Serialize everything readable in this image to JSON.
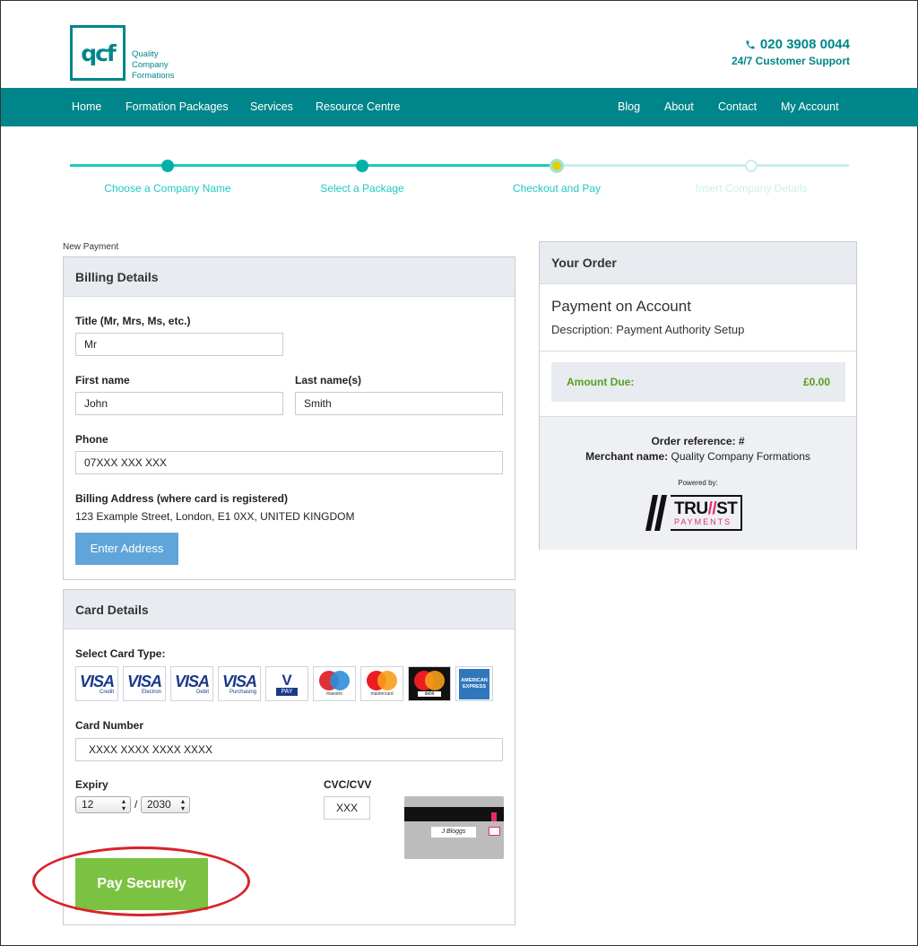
{
  "header": {
    "logo_mark": "qcf",
    "logo_lines": [
      "Quality",
      "Company",
      "Formations"
    ],
    "phone": "020 3908 0044",
    "support": "24/7 Customer Support"
  },
  "nav": {
    "left": [
      "Home",
      "Formation Packages",
      "Services",
      "Resource Centre"
    ],
    "right": [
      "Blog",
      "About",
      "Contact",
      "My Account"
    ]
  },
  "steps": [
    {
      "label": "Choose a Company Name",
      "state": "done"
    },
    {
      "label": "Select a Package",
      "state": "done"
    },
    {
      "label": "Checkout and Pay",
      "state": "current"
    },
    {
      "label": "Insert Company Details",
      "state": "todo"
    }
  ],
  "page": {
    "new_payment": "New Payment"
  },
  "billing": {
    "title": "Billing Details",
    "title_label": "Title (Mr, Mrs, Ms, etc.)",
    "title_value": "Mr",
    "first_label": "First name",
    "first_value": "John",
    "last_label": "Last name(s)",
    "last_value": "Smith",
    "phone_label": "Phone",
    "phone_value": "07XXX XXX XXX",
    "address_label": "Billing Address (where card is registered)",
    "address_value": "123 Example Street, London, E1 0XX, UNITED KINGDOM",
    "enter_address": "Enter Address"
  },
  "card": {
    "title": "Card Details",
    "type_label": "Select Card Type:",
    "types": [
      {
        "name": "visa-credit",
        "text": "VISA",
        "sub": "Credit"
      },
      {
        "name": "visa-electron",
        "text": "VISA",
        "sub": "Electron"
      },
      {
        "name": "visa-debit",
        "text": "VISA",
        "sub": "Debit"
      },
      {
        "name": "visa-purchasing",
        "text": "VISA",
        "sub": "Purchasing"
      },
      {
        "name": "vpay",
        "text": "V",
        "sub": "PAY"
      },
      {
        "name": "maestro",
        "text": "",
        "sub": "maestro"
      },
      {
        "name": "mastercard",
        "text": "",
        "sub": "mastercard"
      },
      {
        "name": "mastercard-debit",
        "text": "",
        "sub": "debit"
      },
      {
        "name": "american-express",
        "text": "AMERICAN EXPRESS",
        "sub": ""
      }
    ],
    "number_label": "Card Number",
    "number_value": "XXXX XXXX XXXX XXXX",
    "expiry_label": "Expiry",
    "expiry_month": "12",
    "expiry_sep": "/",
    "expiry_year": "2030",
    "cvc_label": "CVC/CVV",
    "cvc_value": "XXX",
    "cvv_signature": "J Bloggs",
    "pay_button": "Pay Securely"
  },
  "order": {
    "title": "Your Order",
    "item": "Payment on Account",
    "description": "Description: Payment Authority Setup",
    "amount_label": "Amount Due:",
    "amount_value": "£0.00",
    "ref_label": "Order reference:",
    "ref_value": "#",
    "merchant_label": "Merchant name:",
    "merchant_value": "Quality Company Formations",
    "powered_by": "Powered by:",
    "brand_top_left": "TRU",
    "brand_top_right": "ST",
    "brand_bottom": "PAYMENTS"
  },
  "colors": {
    "brand_teal": "#00868a",
    "progress": "#1ec9c0",
    "pay_green": "#7cc242",
    "enter_blue": "#5fa5d9",
    "highlight_red": "#d8232a",
    "amount_green": "#5a9e1f"
  }
}
